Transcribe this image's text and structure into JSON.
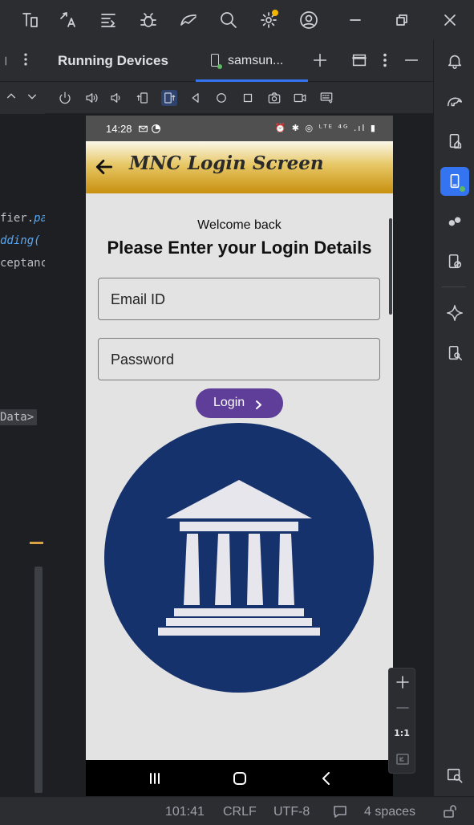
{
  "topbar": {
    "icons": [
      "project-structure-icon",
      "translate-icon",
      "build-variants-icon",
      "debug-icon",
      "profiler-icon",
      "search-icon",
      "settings-icon",
      "account-icon",
      "minimize-icon",
      "restore-icon",
      "close-icon"
    ]
  },
  "editor": {
    "lines": [
      {
        "plain": "fier.",
        "italic": "pa"
      },
      {
        "plain": "",
        "italic": "dding("
      },
      {
        "plain": "ceptanc",
        "italic": ""
      },
      {
        "plain": "Data>",
        "italic": ""
      }
    ]
  },
  "panel": {
    "title": "Running Devices",
    "tab_label": "samsun...",
    "add_tab": "+"
  },
  "device": {
    "status_time": "14:28",
    "status_right": "⏰ ✱ ◎ ᴸᵀᴱ ⁴ᴳ .ıl ▮",
    "app_title": "MNC Login Screen",
    "welcome": "Welcome back",
    "heading": "Please Enter your Login Details",
    "email_placeholder": "Email ID",
    "password_placeholder": "Password",
    "login_label": "Login",
    "logo_circle_color": "#15326d"
  },
  "zoom": {
    "one_to_one": "1:1"
  },
  "statusbar": {
    "position": "101:41",
    "line_ending": "CRLF",
    "encoding": "UTF-8",
    "indent": "4 spaces"
  }
}
